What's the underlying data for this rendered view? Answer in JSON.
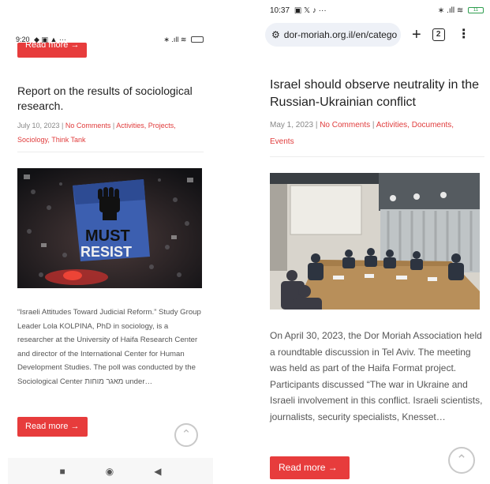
{
  "left": {
    "status": {
      "time": "9:20",
      "left_icons": "◆ ▣ ▲ ···",
      "right_icons": "∗ .ıll ≋"
    },
    "top_readmore": "Read more →",
    "title": "Report on the results of sociological research.",
    "meta": {
      "date": "July 10, 2023",
      "sep": " | ",
      "comments": "No Comments",
      "cats_line1": "Activities, Projects,",
      "cats_line2": "Sociology, Think Tank"
    },
    "photo_text_1": "MUST",
    "photo_text_2": "RESIST",
    "excerpt": "“Israeli Attitudes Toward Judicial Reform.” Study Group Leader Lola KOLPINA, PhD in sociology, is a researcher at the University of Haifa Research Center and director of the International Center for Human Development Studies. The poll was conducted by the Sociological Center מאגר מוחות under…",
    "readmore": "Read more →",
    "scrolltop": "⌃",
    "nav": {
      "square": "■",
      "home": "◉",
      "back": "◀"
    }
  },
  "right": {
    "status": {
      "time": "10:37",
      "left_icons": "▣ 𝕏 ♪ ···",
      "right_icons": "∗ .ıll ≋",
      "battery": "11"
    },
    "url": "dor-moriah.org.il/en/catego",
    "tune_icon": "⚙",
    "plus": "+",
    "tab_count": "2",
    "menu": "⋮",
    "title": "Israel should observe neutrality in the Russian-Ukrainian conflict",
    "meta": {
      "date": "May 1, 2023",
      "sep": " | ",
      "comments": "No Comments",
      "cats": "Activities, Documents,",
      "cats_line2": "Events"
    },
    "excerpt": "On April 30, 2023, the Dor Moriah Association held a roundtable discussion in Tel Aviv. The meeting was held as part of the Haifa Format project. Participants discussed “The war in Ukraine and Israeli involvement in this conflict. Israeli scientists, journalists, security specialists, Knesset…",
    "readmore": "Read more →",
    "scrolltop": "⌃"
  },
  "colors": {
    "accent": "#e73c3c",
    "link": "#e03c3c",
    "meta": "#888888"
  }
}
